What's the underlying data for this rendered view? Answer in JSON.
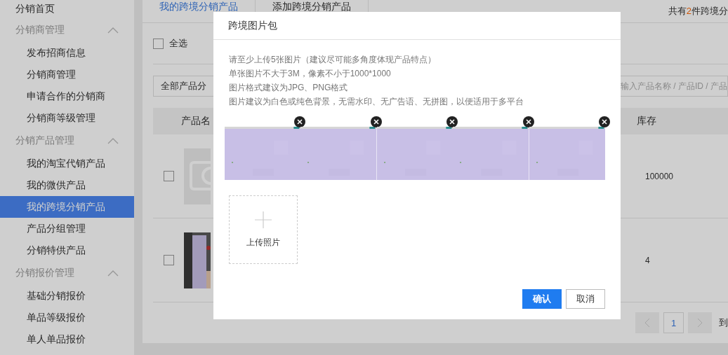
{
  "sidebar": {
    "items": [
      {
        "kind": "link",
        "label": "分销首页",
        "selected": false
      },
      {
        "kind": "group",
        "label": "分销商管理",
        "expanded": true,
        "children": [
          {
            "label": "发布招商信息",
            "selected": false
          },
          {
            "label": "分销商管理",
            "selected": false
          },
          {
            "label": "申请合作的分销商",
            "selected": false
          },
          {
            "label": "分销商等级管理",
            "selected": false
          }
        ]
      },
      {
        "kind": "group",
        "label": "分销产品管理",
        "expanded": true,
        "children": [
          {
            "label": "我的淘宝代销产品",
            "selected": false
          },
          {
            "label": "我的微供产品",
            "selected": false
          },
          {
            "label": "我的跨境分销产品",
            "selected": true
          },
          {
            "label": "产品分组管理",
            "selected": false
          },
          {
            "label": "分销特供产品",
            "selected": false
          }
        ]
      },
      {
        "kind": "group",
        "label": "分销报价管理",
        "expanded": true,
        "children": [
          {
            "label": "基础分销报价",
            "selected": false
          },
          {
            "label": "单品等级报价",
            "selected": false
          },
          {
            "label": "单人单品报价",
            "selected": false
          }
        ]
      }
    ]
  },
  "tabs": [
    {
      "label": "我的跨境分销产品",
      "selected": true
    },
    {
      "label": "添加跨境分销产品",
      "selected": false
    }
  ],
  "summary": {
    "prefix": "共有",
    "count": "2",
    "suffix": "件跨境分"
  },
  "toolbar": {
    "select_all": {
      "label": "全选",
      "checked": false
    }
  },
  "filters": {
    "category": "全部产品分",
    "search": {
      "placeholder": "输入产品名称 / 产品ID / 产品"
    }
  },
  "table": {
    "columns": [
      "产品名",
      "库存"
    ],
    "rows": [
      {
        "checked": false,
        "kind": "placeholder",
        "stock": "100000"
      },
      {
        "checked": false,
        "stock": "4"
      }
    ]
  },
  "pagination": {
    "pages": [
      {
        "label": "1",
        "selected": true
      }
    ],
    "goto": "到"
  },
  "dialog": {
    "title": "跨境图片包",
    "notes": [
      "请至少上传5张图片（建议尽可能多角度体现产品特点）",
      "单张图片不大于3M，像素不小于1000*1000",
      "图片格式建议为JPG、PNG格式",
      "图片建议为白色或纯色背景，无需水印、无广告语、无拼图，以便适用于多平台"
    ],
    "photos": [
      {
        "kind": "picture"
      },
      {
        "kind": "picture"
      },
      {
        "kind": "picture"
      },
      {
        "kind": "picture"
      },
      {
        "kind": "picture"
      }
    ],
    "upload": {
      "label": "上传照片"
    },
    "buttons": [
      {
        "kind": "primary",
        "label": "确认"
      },
      {
        "kind": "default",
        "label": "取消"
      }
    ]
  }
}
